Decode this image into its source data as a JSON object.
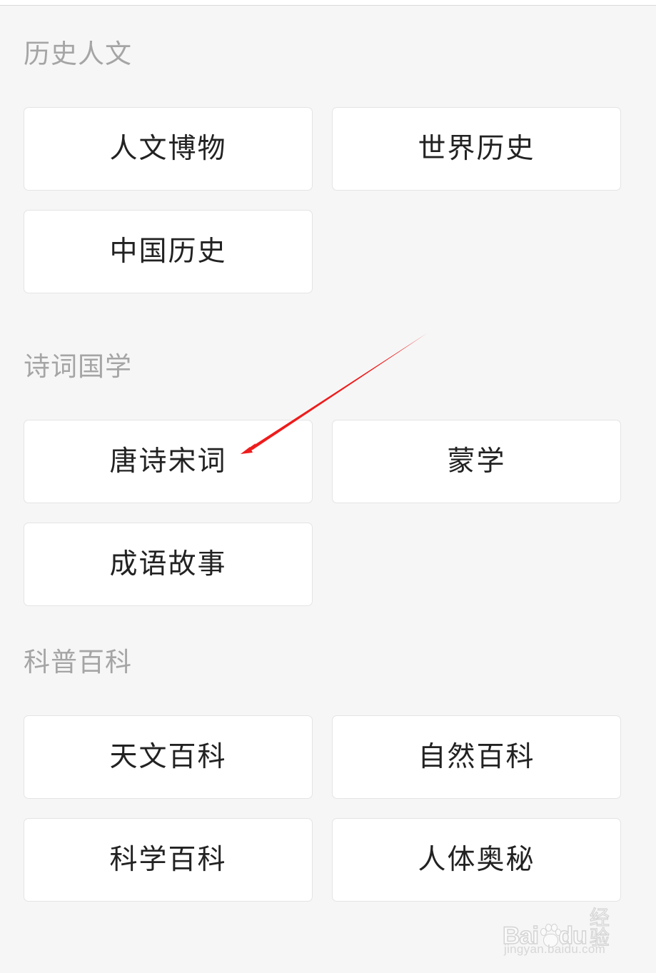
{
  "sections": [
    {
      "title": "历史人文",
      "items": [
        {
          "label": "人文博物"
        },
        {
          "label": "世界历史"
        },
        {
          "label": "中国历史"
        }
      ]
    },
    {
      "title": "诗词国学",
      "items": [
        {
          "label": "唐诗宋词"
        },
        {
          "label": "蒙学"
        },
        {
          "label": "成语故事"
        }
      ]
    },
    {
      "title": "科普百科",
      "items": [
        {
          "label": "天文百科"
        },
        {
          "label": "自然百科"
        },
        {
          "label": "科学百科"
        },
        {
          "label": "人体奥秘"
        }
      ]
    }
  ],
  "annotation": {
    "type": "red-arrow",
    "color": "#ee1c1c",
    "target": "唐诗宋词"
  },
  "watermark": {
    "brand_left": "Bai",
    "brand_right": "du",
    "suffix": "经验",
    "url": "jingyan.baidu.com",
    "paw_icon": "baidu-paw-icon"
  },
  "colors": {
    "background": "#f6f6f6",
    "card": "#ffffff",
    "card_border": "#e4e4e4",
    "section_title": "#a5a5a5",
    "card_text": "#222222"
  }
}
